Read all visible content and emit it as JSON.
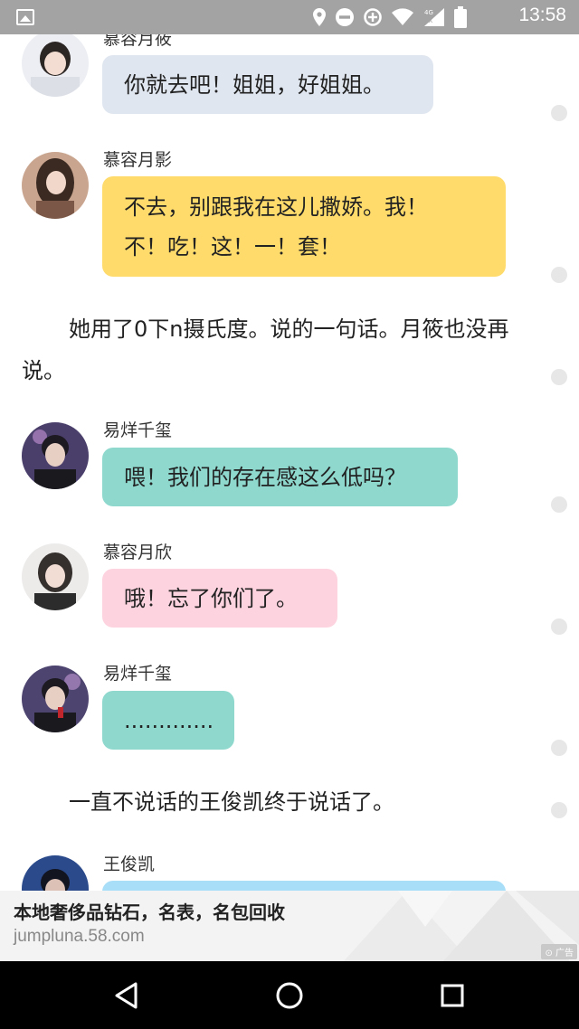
{
  "status_bar": {
    "time": "13:58",
    "network": "4G",
    "network_sub": "1X"
  },
  "messages": [
    {
      "type": "chat",
      "speaker": "慕容月筱",
      "text": "你就去吧！姐姐，好姐姐。",
      "color": "#e0e6ef"
    },
    {
      "type": "chat",
      "speaker": "慕容月影",
      "lines": [
        "不去，别跟我在这儿撒娇。我！",
        "不！吃！这！一！套！"
      ],
      "color": "#ffdb6c"
    },
    {
      "type": "narration",
      "text": "她用了0下n摄氏度。说的一句话。月筱也没再说。"
    },
    {
      "type": "chat",
      "speaker": "易烊千玺",
      "text": "喂！我们的存在感这么低吗？",
      "color": "#8ed8ce"
    },
    {
      "type": "chat",
      "speaker": "慕容月欣",
      "text": "哦！忘了你们了。",
      "color": "#fdd3df"
    },
    {
      "type": "chat",
      "speaker": "易烊千玺",
      "text": ".............",
      "color": "#8ed8ce"
    },
    {
      "type": "narration",
      "text": "一直不说话的王俊凯终于说话了。"
    },
    {
      "type": "chat",
      "speaker": "王俊凯",
      "text": "",
      "color": "#a9def8"
    }
  ],
  "ad": {
    "title": "本地奢侈品钻石，名表，名包回收",
    "url": "jumpluna.58.com",
    "badge": "广告"
  },
  "nav": {
    "back_icon": "back-triangle-icon",
    "home_icon": "home-circle-icon",
    "recents_icon": "recents-square-icon"
  }
}
